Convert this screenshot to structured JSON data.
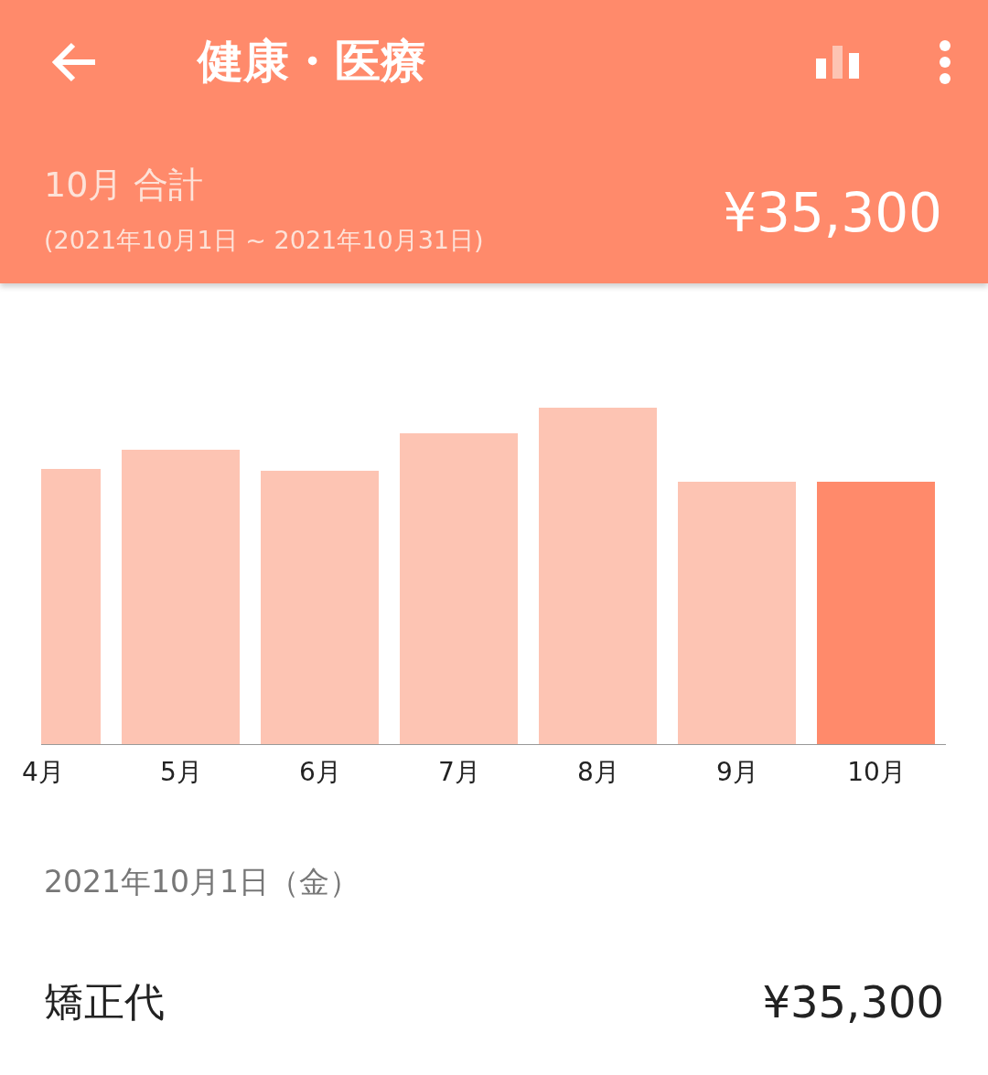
{
  "app_bar": {
    "title": "健康・医療"
  },
  "summary": {
    "label": "10月 合計",
    "period": "(2021年10月1日 ~ 2021年10月31日)",
    "total": "¥35,300"
  },
  "chart": {
    "bars": [
      {
        "label": "4月",
        "selected": false
      },
      {
        "label": "5月",
        "selected": false
      },
      {
        "label": "6月",
        "selected": false
      },
      {
        "label": "7月",
        "selected": false
      },
      {
        "label": "8月",
        "selected": false
      },
      {
        "label": "9月",
        "selected": false
      },
      {
        "label": "10月",
        "selected": true
      }
    ]
  },
  "entries": [
    {
      "date": "2021年10月1日（金）",
      "items": [
        {
          "name": "矯正代",
          "amount": "¥35,300"
        }
      ]
    }
  ]
}
